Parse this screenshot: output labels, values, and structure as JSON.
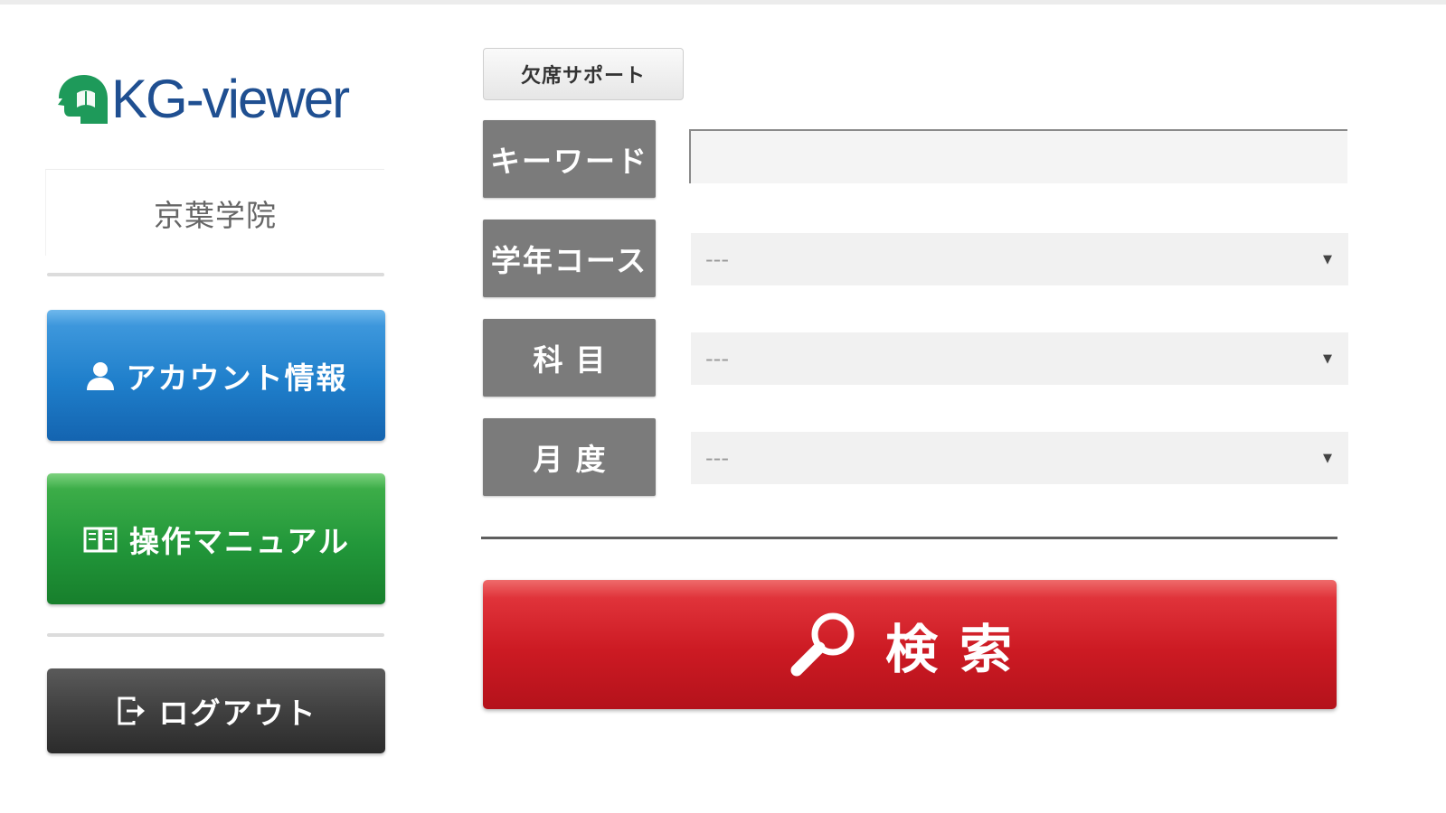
{
  "logo": {
    "text": "KG-viewer",
    "mark_icon": "reading-head-icon",
    "color": "#1f4f91",
    "mark_color": "#1e9a5a"
  },
  "sidebar": {
    "school_name": "京葉学院",
    "buttons": {
      "account": {
        "label": "アカウント情報",
        "icon": "user-icon",
        "color": "#1f7fcb"
      },
      "manual": {
        "label": "操作マニュアル",
        "icon": "book-icon",
        "color": "#22973a"
      },
      "logout": {
        "label": "ログアウト",
        "icon": "logout-icon",
        "color": "#333333"
      }
    }
  },
  "main": {
    "support_button": "欠席サポート",
    "fields": {
      "keyword": {
        "label": "キーワード",
        "value": "",
        "placeholder": ""
      },
      "course": {
        "label": "学年コース",
        "selected": "---"
      },
      "subject": {
        "label": "科目",
        "selected": "---"
      },
      "month": {
        "label": "月度",
        "selected": "---"
      }
    },
    "search_button": {
      "label": "検索",
      "icon": "search-icon",
      "color": "#cc1a23"
    }
  }
}
